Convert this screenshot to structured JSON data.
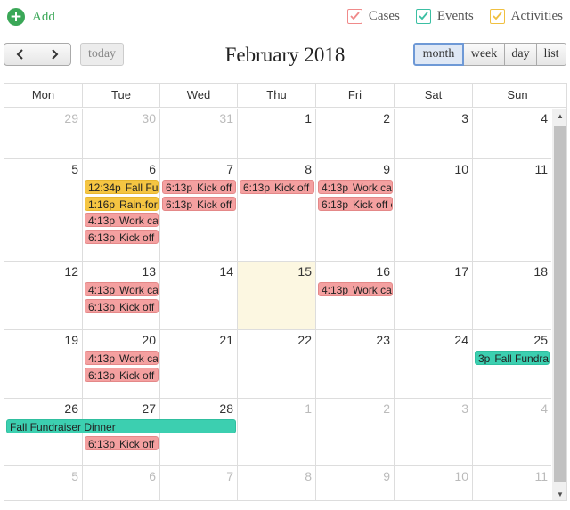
{
  "header": {
    "add_label": "Add",
    "filters": [
      {
        "label": "Cases",
        "color": "#f08a8a",
        "checked": true
      },
      {
        "label": "Events",
        "color": "#3bbfa3",
        "checked": true
      },
      {
        "label": "Activities",
        "color": "#f0c040",
        "checked": true
      }
    ]
  },
  "toolbar": {
    "prev_icon": "chevron-left-icon",
    "next_icon": "chevron-right-icon",
    "today_label": "today",
    "title": "February 2018",
    "views": [
      {
        "label": "month",
        "active": true
      },
      {
        "label": "week",
        "active": false
      },
      {
        "label": "day",
        "active": false
      },
      {
        "label": "list",
        "active": false
      }
    ]
  },
  "calendar": {
    "days_of_week": [
      "Mon",
      "Tue",
      "Wed",
      "Thu",
      "Fri",
      "Sat",
      "Sun"
    ],
    "weeks": [
      {
        "days": [
          {
            "n": "29",
            "other": true
          },
          {
            "n": "30",
            "other": true
          },
          {
            "n": "31",
            "other": true
          },
          {
            "n": "1"
          },
          {
            "n": "2"
          },
          {
            "n": "3"
          },
          {
            "n": "4"
          }
        ]
      },
      {
        "days": [
          {
            "n": "5"
          },
          {
            "n": "6"
          },
          {
            "n": "7"
          },
          {
            "n": "8"
          },
          {
            "n": "9"
          },
          {
            "n": "10"
          },
          {
            "n": "11"
          }
        ]
      },
      {
        "days": [
          {
            "n": "12"
          },
          {
            "n": "13"
          },
          {
            "n": "14"
          },
          {
            "n": "15",
            "today": true
          },
          {
            "n": "16"
          },
          {
            "n": "17"
          },
          {
            "n": "18"
          }
        ]
      },
      {
        "days": [
          {
            "n": "19"
          },
          {
            "n": "20"
          },
          {
            "n": "21"
          },
          {
            "n": "22"
          },
          {
            "n": "23"
          },
          {
            "n": "24"
          },
          {
            "n": "25"
          }
        ]
      },
      {
        "days": [
          {
            "n": "26"
          },
          {
            "n": "27"
          },
          {
            "n": "28"
          },
          {
            "n": "1",
            "other": true
          },
          {
            "n": "2",
            "other": true
          },
          {
            "n": "3",
            "other": true
          },
          {
            "n": "4",
            "other": true
          }
        ]
      },
      {
        "days": [
          {
            "n": "5",
            "other": true
          },
          {
            "n": "6",
            "other": true
          },
          {
            "n": "7",
            "other": true
          },
          {
            "n": "8",
            "other": true
          },
          {
            "n": "9",
            "other": true
          },
          {
            "n": "10",
            "other": true
          },
          {
            "n": "11",
            "other": true
          }
        ]
      }
    ],
    "events": [
      {
        "week": 1,
        "day": 1,
        "row": 0,
        "span": 1,
        "time": "12:34p",
        "title": "Fall Fundraiser",
        "kind": "activity"
      },
      {
        "week": 1,
        "day": 1,
        "row": 1,
        "span": 1,
        "time": "1:16p",
        "title": "Rain-forest",
        "kind": "activity"
      },
      {
        "week": 1,
        "day": 1,
        "row": 2,
        "span": 1,
        "time": "4:13p",
        "title": "Work case",
        "kind": "case"
      },
      {
        "week": 1,
        "day": 1,
        "row": 3,
        "span": 1,
        "time": "6:13p",
        "title": "Kick off case",
        "kind": "case"
      },
      {
        "week": 1,
        "day": 2,
        "row": 0,
        "span": 1,
        "time": "6:13p",
        "title": "Kick off case",
        "kind": "case"
      },
      {
        "week": 1,
        "day": 2,
        "row": 1,
        "span": 1,
        "time": "6:13p",
        "title": "Kick off case",
        "kind": "case"
      },
      {
        "week": 1,
        "day": 3,
        "row": 0,
        "span": 1,
        "time": "6:13p",
        "title": "Kick off case",
        "kind": "case"
      },
      {
        "week": 1,
        "day": 4,
        "row": 0,
        "span": 1,
        "time": "4:13p",
        "title": "Work case",
        "kind": "case"
      },
      {
        "week": 1,
        "day": 4,
        "row": 1,
        "span": 1,
        "time": "6:13p",
        "title": "Kick off case",
        "kind": "case"
      },
      {
        "week": 2,
        "day": 1,
        "row": 0,
        "span": 1,
        "time": "4:13p",
        "title": "Work case",
        "kind": "case"
      },
      {
        "week": 2,
        "day": 1,
        "row": 1,
        "span": 1,
        "time": "6:13p",
        "title": "Kick off case",
        "kind": "case"
      },
      {
        "week": 2,
        "day": 4,
        "row": 0,
        "span": 1,
        "time": "4:13p",
        "title": "Work case",
        "kind": "case"
      },
      {
        "week": 3,
        "day": 1,
        "row": 0,
        "span": 1,
        "time": "4:13p",
        "title": "Work case",
        "kind": "case"
      },
      {
        "week": 3,
        "day": 1,
        "row": 1,
        "span": 1,
        "time": "6:13p",
        "title": "Kick off case",
        "kind": "case"
      },
      {
        "week": 3,
        "day": 6,
        "row": 0,
        "span": 1,
        "time": "3p",
        "title": "Fall Fundraiser Dinner",
        "kind": "event"
      },
      {
        "week": 4,
        "day": 0,
        "row": 0,
        "span": 3,
        "time": "",
        "title": "Fall Fundraiser Dinner",
        "kind": "event"
      },
      {
        "week": 4,
        "day": 1,
        "row": 1,
        "span": 1,
        "time": "6:13p",
        "title": "Kick off case",
        "kind": "case"
      }
    ],
    "colors": {
      "case": {
        "bg": "#f4a0a0",
        "border": "#e48888"
      },
      "event": {
        "bg": "#3ccfb0",
        "border": "#2fbf9f"
      },
      "activity": {
        "bg": "#f5c542",
        "border": "#e8b62e"
      }
    }
  },
  "scrollbar": {
    "up_icon": "scroll-up-arrow-icon",
    "down_icon": "scroll-down-arrow-icon"
  }
}
